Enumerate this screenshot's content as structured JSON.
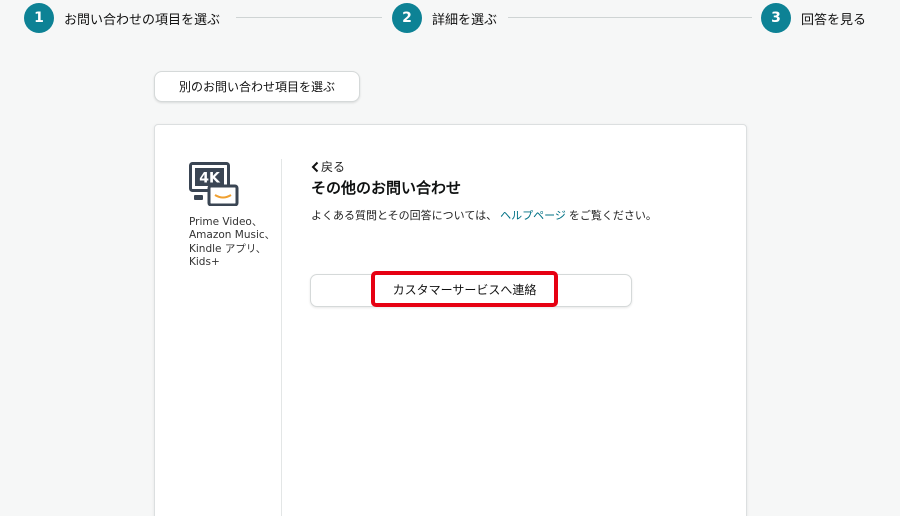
{
  "steps": [
    {
      "number": "1",
      "label": "お問い合わせの項目を選ぶ"
    },
    {
      "number": "2",
      "label": "詳細を選ぶ"
    },
    {
      "number": "3",
      "label": "回答を見る"
    }
  ],
  "choose_another": {
    "label": "別のお問い合わせ項目を選ぶ"
  },
  "category": {
    "icon": "tv-4k-icon",
    "icon_text": "4K",
    "caption": "Prime Video、Amazon Music、Kindle アプリ、Kids+"
  },
  "detail": {
    "back_label": "戻る",
    "title": "その他のお問い合わせ",
    "desc_before": "よくある質問とその回答については、",
    "help_link": "ヘルプページ",
    "desc_after": "をご覧ください。",
    "contact_button": "カスタマーサービスへ連絡"
  },
  "colors": {
    "accent": "#0d8295",
    "link": "#007185",
    "highlight": "#e60012"
  }
}
